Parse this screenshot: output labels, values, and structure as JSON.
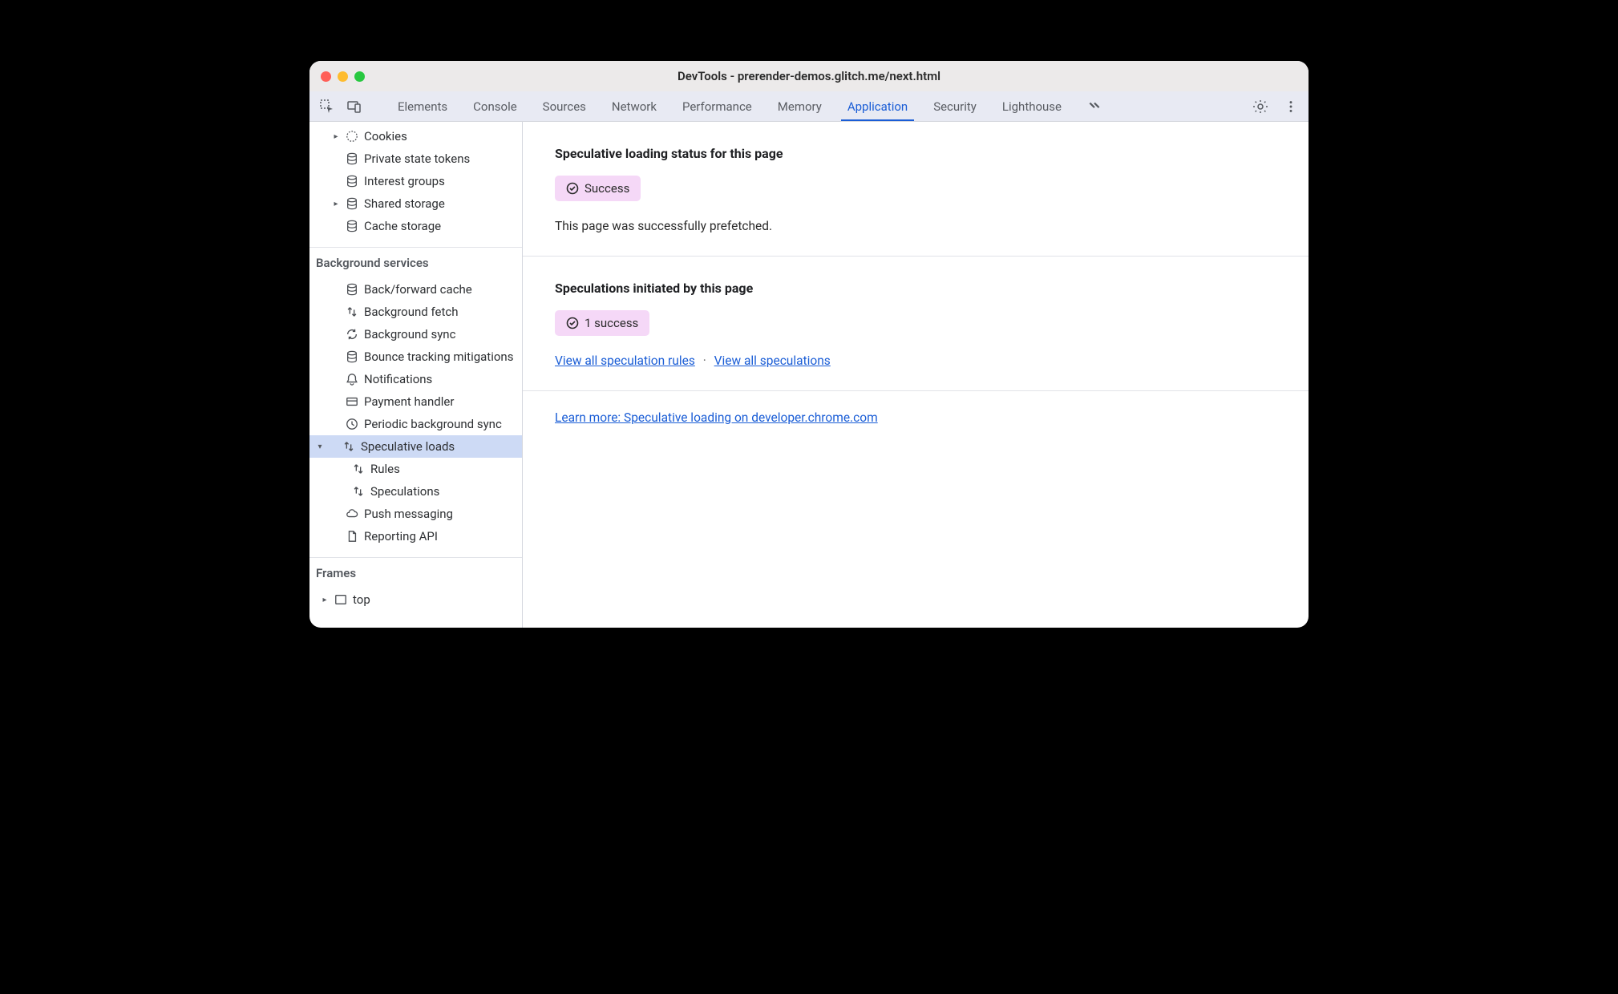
{
  "window_title": "DevTools - prerender-demos.glitch.me/next.html",
  "tabs": {
    "elements": "Elements",
    "console": "Console",
    "sources": "Sources",
    "network": "Network",
    "performance": "Performance",
    "memory": "Memory",
    "application": "Application",
    "security": "Security",
    "lighthouse": "Lighthouse"
  },
  "sidebar": {
    "storage_items": {
      "cookies": "Cookies",
      "private_state_tokens": "Private state tokens",
      "interest_groups": "Interest groups",
      "shared_storage": "Shared storage",
      "cache_storage": "Cache storage"
    },
    "background_header": "Background services",
    "background_items": {
      "back_forward_cache": "Back/forward cache",
      "background_fetch": "Background fetch",
      "background_sync": "Background sync",
      "bounce_tracking": "Bounce tracking mitigations",
      "notifications": "Notifications",
      "payment_handler": "Payment handler",
      "periodic_sync": "Periodic background sync",
      "speculative_loads": "Speculative loads",
      "rules": "Rules",
      "speculations": "Speculations",
      "push_messaging": "Push messaging",
      "reporting_api": "Reporting API"
    },
    "frames_header": "Frames",
    "frames_top": "top"
  },
  "content": {
    "status_heading": "Speculative loading status for this page",
    "status_badge": "Success",
    "status_desc": "This page was successfully prefetched.",
    "initiated_heading": "Speculations initiated by this page",
    "initiated_badge": "1 success",
    "link_rules": "View all speculation rules",
    "link_specs": "View all speculations",
    "separator": "·",
    "learn_more": "Learn more: Speculative loading on developer.chrome.com"
  }
}
